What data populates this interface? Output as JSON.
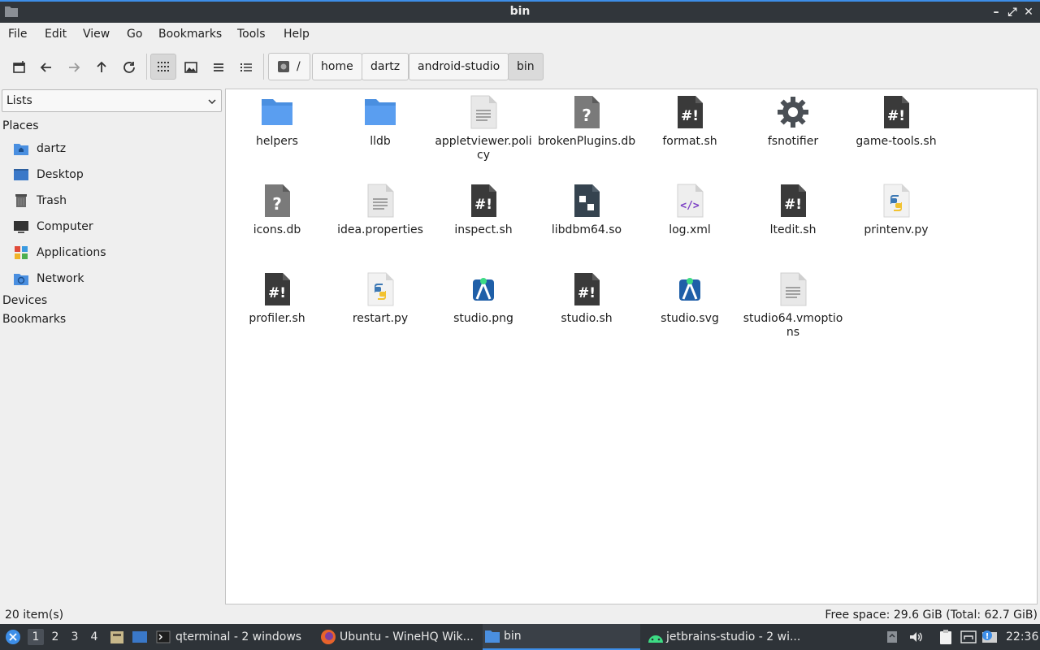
{
  "window": {
    "title": "bin"
  },
  "menu": [
    "File",
    "Edit",
    "View",
    "Go",
    "Bookmarks",
    "Tools",
    "Help"
  ],
  "breadcrumbs": [
    "/",
    "home",
    "dartz",
    "android-studio",
    "bin"
  ],
  "sidebar": {
    "view_mode": "Lists",
    "sections": {
      "places": "Places",
      "devices": "Devices",
      "bookmarks": "Bookmarks"
    },
    "places": [
      {
        "label": "dartz",
        "icon": "home-folder-icon"
      },
      {
        "label": "Desktop",
        "icon": "desktop-icon"
      },
      {
        "label": "Trash",
        "icon": "trash-icon"
      },
      {
        "label": "Computer",
        "icon": "computer-icon"
      },
      {
        "label": "Applications",
        "icon": "applications-icon"
      },
      {
        "label": "Network",
        "icon": "network-icon"
      }
    ]
  },
  "files": [
    {
      "name": "helpers",
      "type": "folder"
    },
    {
      "name": "lldb",
      "type": "folder"
    },
    {
      "name": "appletviewer.policy",
      "type": "text"
    },
    {
      "name": "brokenPlugins.db",
      "type": "unknown"
    },
    {
      "name": "format.sh",
      "type": "script"
    },
    {
      "name": "fsnotifier",
      "type": "executable"
    },
    {
      "name": "game-tools.sh",
      "type": "script"
    },
    {
      "name": "icons.db",
      "type": "unknown"
    },
    {
      "name": "idea.properties",
      "type": "text"
    },
    {
      "name": "inspect.sh",
      "type": "script"
    },
    {
      "name": "libdbm64.so",
      "type": "library"
    },
    {
      "name": "log.xml",
      "type": "xml"
    },
    {
      "name": "ltedit.sh",
      "type": "script"
    },
    {
      "name": "printenv.py",
      "type": "python"
    },
    {
      "name": "profiler.sh",
      "type": "script"
    },
    {
      "name": "restart.py",
      "type": "python"
    },
    {
      "name": "studio.png",
      "type": "studio-image"
    },
    {
      "name": "studio.sh",
      "type": "script"
    },
    {
      "name": "studio.svg",
      "type": "studio-image"
    },
    {
      "name": "studio64.vmoptions",
      "type": "text"
    }
  ],
  "status": {
    "count": "20 item(s)",
    "free_space": "Free space: 29.6 GiB (Total: 62.7 GiB)"
  },
  "taskbar": {
    "workspaces": [
      "1",
      "2",
      "3",
      "4"
    ],
    "active_workspace": "1",
    "windows": [
      {
        "label": "qterminal - 2 windows",
        "icon": "terminal-icon"
      },
      {
        "label": "Ubuntu - WineHQ Wik...",
        "icon": "firefox-icon"
      },
      {
        "label": "bin",
        "icon": "folder-icon"
      },
      {
        "label": "jetbrains-studio - 2 wi...",
        "icon": "android-icon"
      }
    ],
    "clock": "22:36"
  },
  "colors": {
    "accent": "#3d8ee8",
    "folder": "#4a8fe0",
    "script": "#3a3a3a",
    "taskbar": "#2e3338"
  }
}
